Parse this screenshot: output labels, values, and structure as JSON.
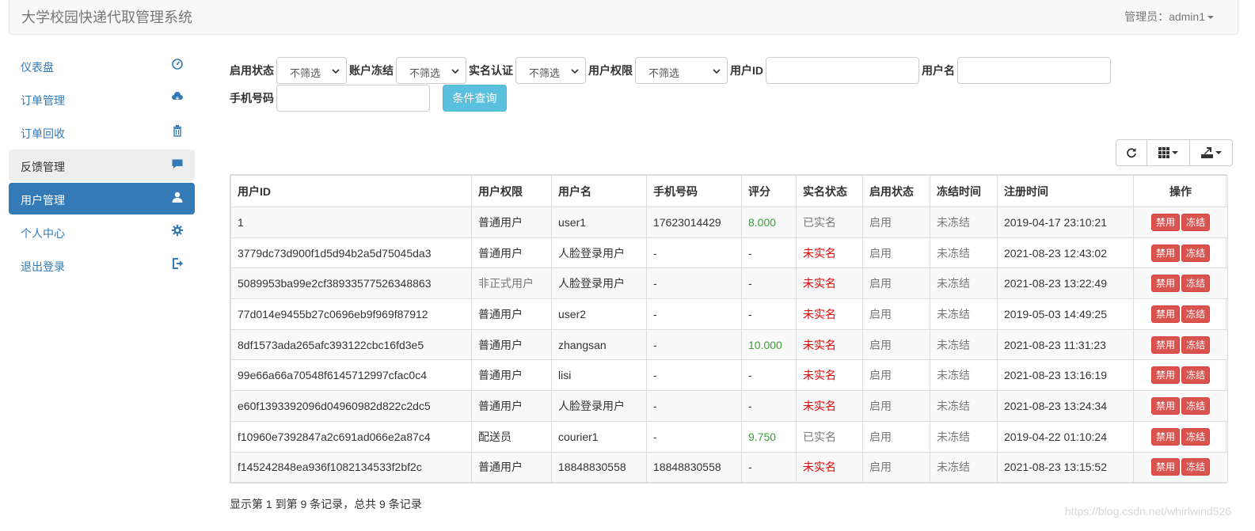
{
  "header": {
    "title": "大学校园快递代取管理系统",
    "admin_label": "管理员：admin1"
  },
  "sidebar": {
    "items": [
      {
        "label": "仪表盘",
        "icon": "dashboard-icon"
      },
      {
        "label": "订单管理",
        "icon": "cloud-upload-icon"
      },
      {
        "label": "订单回收",
        "icon": "trash-icon"
      },
      {
        "label": "反馈管理",
        "icon": "comment-icon"
      },
      {
        "label": "用户管理",
        "icon": "user-icon"
      },
      {
        "label": "个人中心",
        "icon": "gear-icon"
      },
      {
        "label": "退出登录",
        "icon": "logout-icon"
      }
    ]
  },
  "filters": {
    "status_label": "启用状态",
    "status_value": "不筛选",
    "freeze_label": "账户冻结",
    "freeze_value": "不筛选",
    "realname_label": "实名认证",
    "realname_value": "不筛选",
    "role_label": "用户权限",
    "role_value": "不筛选",
    "userid_label": "用户ID",
    "userid_value": "",
    "username_label": "用户名",
    "username_value": "",
    "phone_label": "手机号码",
    "phone_value": "",
    "query_button": "条件查询"
  },
  "table": {
    "headers": [
      "用户ID",
      "用户权限",
      "用户名",
      "手机号码",
      "评分",
      "实名状态",
      "启用状态",
      "冻结时间",
      "注册时间",
      "操作"
    ],
    "disable_label": "禁用",
    "freeze_label": "冻结",
    "rows": [
      [
        "1",
        "普通用户",
        "user1",
        "17623014429",
        "8.000",
        "已实名",
        "启用",
        "未冻结",
        "2019-04-17 23:10:21"
      ],
      [
        "3779dc73d900f1d5d94b2a5d75045da3",
        "普通用户",
        "人脸登录用户",
        "-",
        "-",
        "未实名",
        "启用",
        "未冻结",
        "2021-08-23 12:43:02"
      ],
      [
        "5089953ba99e2cf38933577526348863",
        "非正式用户",
        "人脸登录用户",
        "-",
        "-",
        "未实名",
        "启用",
        "未冻结",
        "2021-08-23 13:22:49"
      ],
      [
        "77d014e9455b27c0696eb9f969f87912",
        "普通用户",
        "user2",
        "-",
        "-",
        "未实名",
        "启用",
        "未冻结",
        "2019-05-03 14:49:25"
      ],
      [
        "8df1573ada265afc393122cbc16fd3e5",
        "普通用户",
        "zhangsan",
        "-",
        "10.000",
        "未实名",
        "启用",
        "未冻结",
        "2021-08-23 11:31:23"
      ],
      [
        "99e66a66a70548f6145712997cfac0c4",
        "普通用户",
        "lisi",
        "-",
        "-",
        "未实名",
        "启用",
        "未冻结",
        "2021-08-23 13:16:19"
      ],
      [
        "e60f1393392096d04960982d822c2dc5",
        "普通用户",
        "人脸登录用户",
        "-",
        "-",
        "未实名",
        "启用",
        "未冻结",
        "2021-08-23 13:24:34"
      ],
      [
        "f10960e7392847a2c691ad066e2a87c4",
        "配送员",
        "courier1",
        "-",
        "9.750",
        "已实名",
        "启用",
        "未冻结",
        "2019-04-22 01:10:24"
      ],
      [
        "f145242848ea936f1082134533f2bf2c",
        "普通用户",
        "18848830558",
        "18848830558",
        "-",
        "未实名",
        "启用",
        "未冻结",
        "2021-08-23 13:15:52"
      ]
    ]
  },
  "footer": {
    "info": "显示第 1 到第 9 条记录，总共 9 条记录"
  },
  "watermark": "https://blog.csdn.net/whirlwind526",
  "colors": {
    "primary": "#337ab7",
    "info": "#5bc0de",
    "danger": "#d9534f",
    "score_green": "#3c9a3c",
    "unverified_red": "#e00000"
  }
}
